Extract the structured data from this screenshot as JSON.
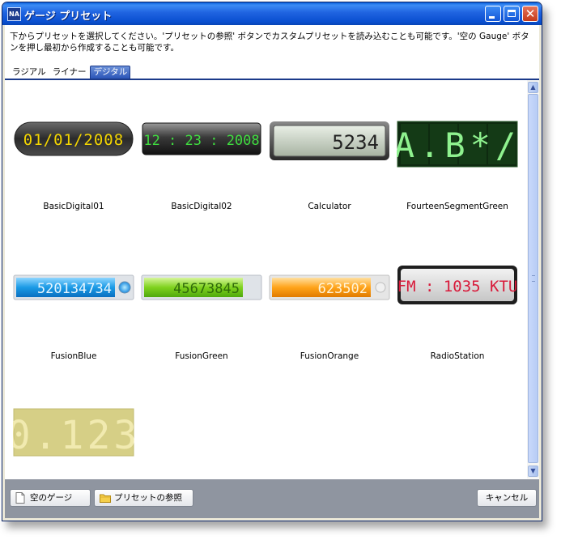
{
  "window": {
    "title": "ゲージ プリセット",
    "app_icon_text": "NA"
  },
  "description": "下からプリセットを選択してください。'プリセットの参照' ボタンでカスタムプリセットを読み込むことも可能です。'空の Gauge' ボタンを押し最初から作成することも可能です。",
  "tabs": [
    {
      "label": "ラジアル",
      "active": false
    },
    {
      "label": "ライナー",
      "active": false
    },
    {
      "label": "デジタル",
      "active": true
    }
  ],
  "presets": [
    {
      "name": "BasicDigital01",
      "display": "01/01/2008"
    },
    {
      "name": "BasicDigital02",
      "display": "12 : 23 : 2008"
    },
    {
      "name": "Calculator",
      "display": "5234"
    },
    {
      "name": "FourteenSegmentGreen",
      "display": "A.B*/"
    },
    {
      "name": "FusionBlue",
      "display": "520134734"
    },
    {
      "name": "FusionGreen",
      "display": "45673845"
    },
    {
      "name": "FusionOrange",
      "display": "623502"
    },
    {
      "name": "RadioStation",
      "display": "FM : 1035 KTU"
    },
    {
      "name": "",
      "display": "0.123"
    }
  ],
  "buttons": {
    "empty_gauge": "空のゲージ",
    "browse_presets": "プリセットの参照",
    "cancel": "キャンセル"
  },
  "colors": {
    "titlebar": "#0a5fdc",
    "footer": "#8f95a0",
    "active_tab": "#2b55b8"
  }
}
